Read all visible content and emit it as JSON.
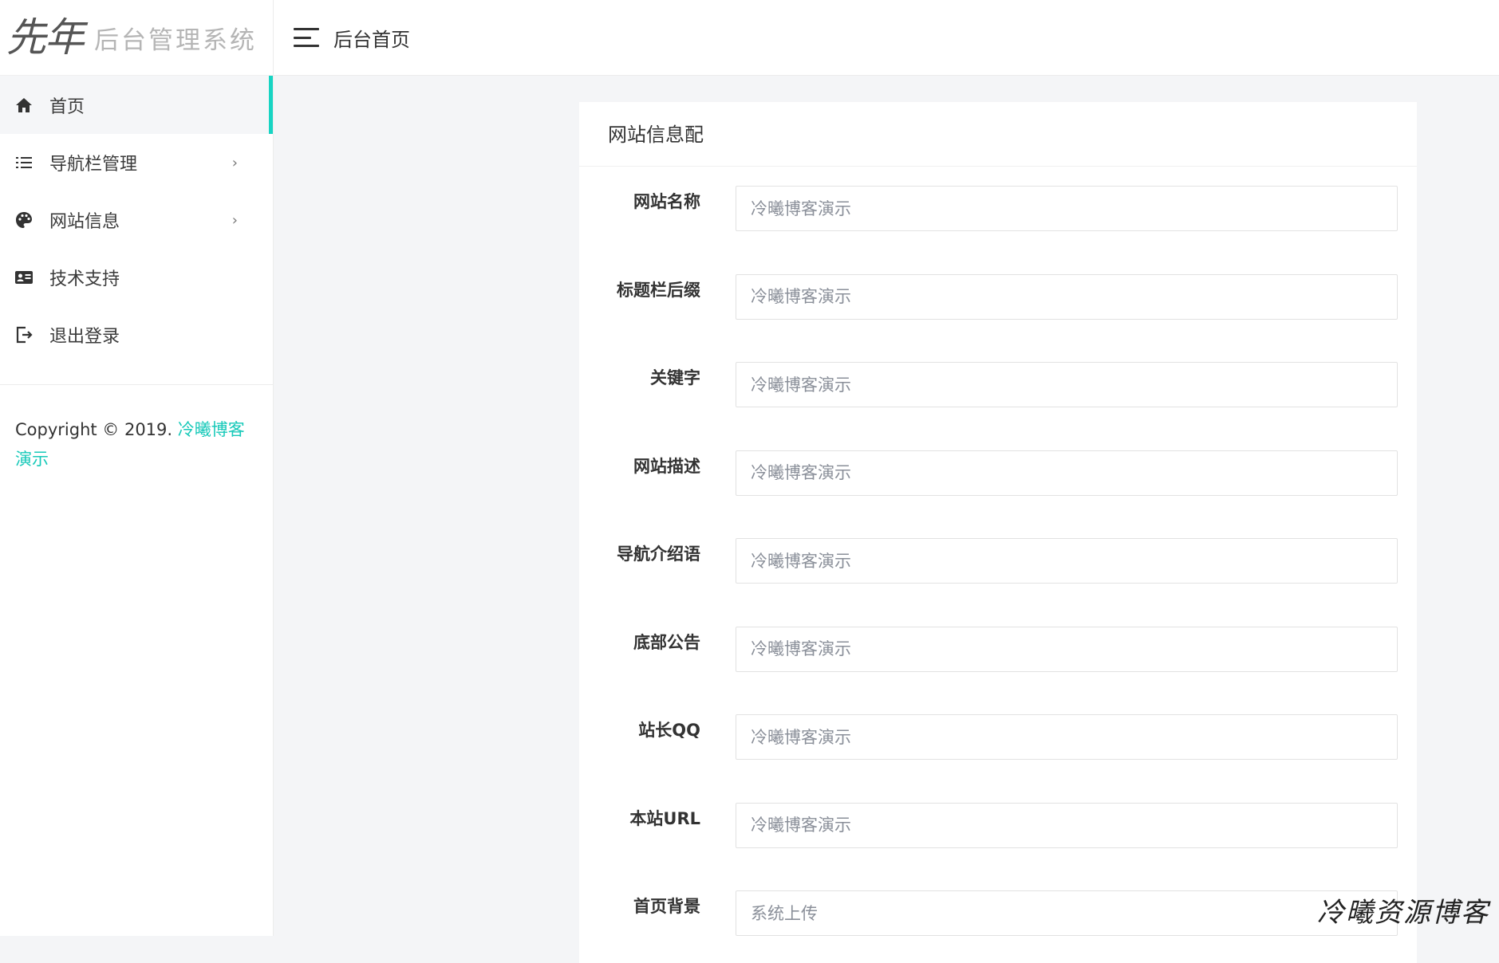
{
  "brand": {
    "logo_text": "先年",
    "name": "后台管理系统"
  },
  "header": {
    "title": "后台首页"
  },
  "sidebar": {
    "items": [
      {
        "label": "首页",
        "icon": "home-icon",
        "active": true,
        "has_submenu": false
      },
      {
        "label": "导航栏管理",
        "icon": "list-icon",
        "active": false,
        "has_submenu": true
      },
      {
        "label": "网站信息",
        "icon": "palette-icon",
        "active": false,
        "has_submenu": true
      },
      {
        "label": "技术支持",
        "icon": "id-card-icon",
        "active": false,
        "has_submenu": false
      },
      {
        "label": "退出登录",
        "icon": "logout-icon",
        "active": false,
        "has_submenu": false
      }
    ],
    "submenu_arrow": "›",
    "copyright_prefix": "Copyright © 2019.",
    "copyright_site": "冷曦博客演示"
  },
  "form": {
    "title": "网站信息配",
    "fields": [
      {
        "label": "网站名称",
        "placeholder": "冷曦博客演示"
      },
      {
        "label": "标题栏后缀",
        "placeholder": "冷曦博客演示"
      },
      {
        "label": "关键字",
        "placeholder": "冷曦博客演示"
      },
      {
        "label": "网站描述",
        "placeholder": "冷曦博客演示"
      },
      {
        "label": "导航介绍语",
        "placeholder": "冷曦博客演示"
      },
      {
        "label": "底部公告",
        "placeholder": "冷曦博客演示"
      },
      {
        "label": "站长QQ",
        "placeholder": "冷曦博客演示"
      },
      {
        "label": "本站URL",
        "placeholder": "冷曦博客演示"
      },
      {
        "label": "首页背景",
        "placeholder": "系统上传"
      }
    ]
  },
  "watermark": "冷曦资源博客",
  "colors": {
    "accent": "#17d4c3",
    "link": "#17c9b9",
    "background": "#f4f5f7"
  }
}
